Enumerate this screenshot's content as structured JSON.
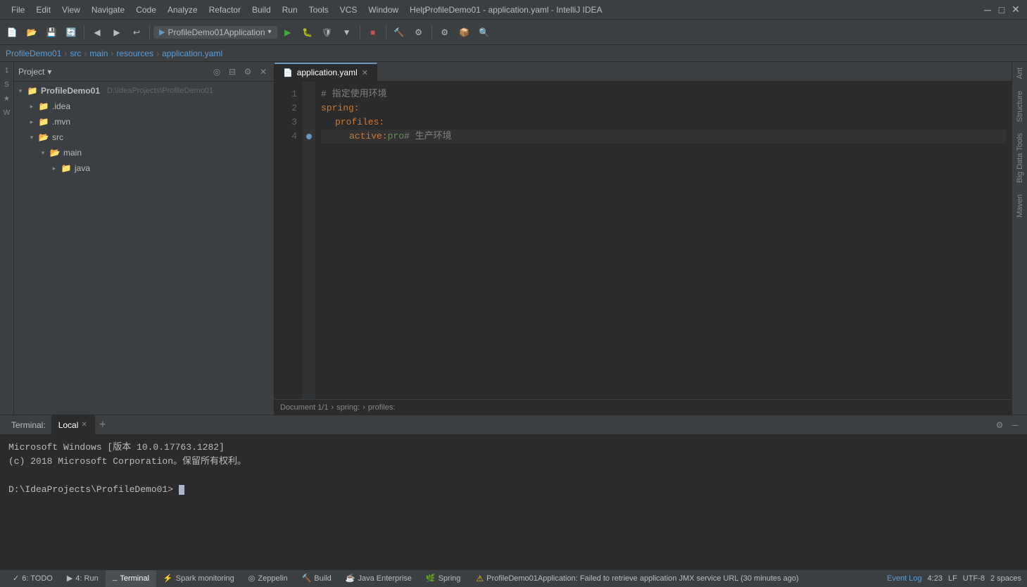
{
  "titleBar": {
    "title": "ProfileDemo01 - application.yaml - IntelliJ IDEA",
    "menus": [
      "File",
      "Edit",
      "View",
      "Navigate",
      "Code",
      "Analyze",
      "Refactor",
      "Build",
      "Run",
      "Tools",
      "VCS",
      "Window",
      "Help"
    ],
    "controls": [
      "─",
      "□",
      "✕"
    ]
  },
  "toolbar": {
    "runConfig": "ProfileDemo01Application",
    "dropdownIcon": "▾"
  },
  "breadcrumb": {
    "items": [
      "ProfileDemo01",
      "src",
      "main",
      "resources",
      "application.yaml"
    ]
  },
  "projectPanel": {
    "title": "Project",
    "dropdownIcon": "▾",
    "tree": [
      {
        "indent": 0,
        "arrow": "▾",
        "icon": "module",
        "label": "ProfileDemo01",
        "extra": "D:\\IdeaProjects\\ProfileDemo01",
        "selected": false
      },
      {
        "indent": 1,
        "arrow": "",
        "icon": "folder",
        "label": ".idea",
        "selected": false
      },
      {
        "indent": 1,
        "arrow": "",
        "icon": "folder",
        "label": ".mvn",
        "selected": false
      },
      {
        "indent": 1,
        "arrow": "▾",
        "icon": "folder-open",
        "label": "src",
        "selected": false
      },
      {
        "indent": 2,
        "arrow": "▾",
        "icon": "folder-open",
        "label": "main",
        "selected": false
      },
      {
        "indent": 3,
        "arrow": "▸",
        "icon": "folder",
        "label": "java",
        "selected": false
      }
    ]
  },
  "editor": {
    "tabs": [
      {
        "id": "application-yaml",
        "label": "application.yaml",
        "active": true,
        "icon": "yaml"
      }
    ],
    "lines": [
      {
        "num": 1,
        "content": "# 指定使用环境",
        "type": "comment"
      },
      {
        "num": 2,
        "content": "spring:",
        "type": "key"
      },
      {
        "num": 3,
        "content": "  profiles:",
        "type": "key",
        "indent": 2
      },
      {
        "num": 4,
        "content": "    active: pro # 生产环境",
        "type": "mixed",
        "highlighted": true
      }
    ],
    "breadcrumb": {
      "docInfo": "Document 1/1",
      "path": "spring:",
      "subpath": "profiles:"
    }
  },
  "terminal": {
    "label": "Terminal:",
    "tabs": [
      {
        "id": "local",
        "label": "Local",
        "active": true
      }
    ],
    "addBtn": "+",
    "lines": [
      "Microsoft Windows [版本 10.0.17763.1282]",
      "(c) 2018 Microsoft Corporation。保留所有权利。",
      "",
      "D:\\IdeaProjects\\ProfileDemo01>"
    ]
  },
  "statusBar": {
    "tabs": [
      {
        "id": "todo",
        "label": "6: TODO",
        "active": false,
        "icon": "✓"
      },
      {
        "id": "run",
        "label": "4: Run",
        "active": false,
        "icon": "▶"
      },
      {
        "id": "terminal",
        "label": "Terminal",
        "active": true,
        "icon": ">"
      },
      {
        "id": "spark-monitoring",
        "label": "Spark monitoring",
        "active": false,
        "icon": "⚡"
      },
      {
        "id": "zeppelin",
        "label": "Zeppelin",
        "active": false,
        "icon": "◎"
      },
      {
        "id": "build",
        "label": "Build",
        "active": false,
        "icon": "🔨"
      },
      {
        "id": "java-enterprise",
        "label": "Java Enterprise",
        "active": false,
        "icon": "☕"
      },
      {
        "id": "spring",
        "label": "Spring",
        "active": false,
        "icon": "🌿"
      }
    ],
    "right": {
      "eventLog": "Event Log",
      "position": "4:23",
      "lineEnding": "LF",
      "encoding": "UTF-8",
      "spaces": "2 spaces"
    },
    "warningMessage": "ProfileDemo01Application: Failed to retrieve application JMX service URL (30 minutes ago)"
  },
  "rightSidebar": {
    "panels": [
      "Ant",
      "Structure",
      "Big Data Tools",
      "Maven"
    ]
  }
}
